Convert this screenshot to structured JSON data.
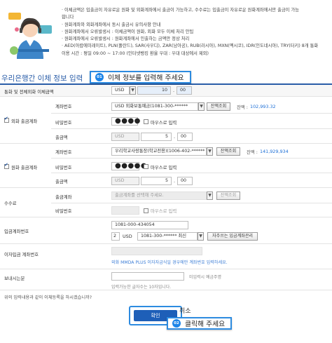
{
  "notice": {
    "lines": [
      "· 이체금액은 입출금이 자유로운 원화 및 외화계좌에서 출금이 가능하고, 수수료는 입출금이 자유로운 원화계좌에서만 출금이 가능",
      "  합니다",
      "· 원화계좌와 외화계좌에서 동시 출금시 유의사항 안내",
      "  · 원화계좌에서 오류발생시 : 이체금액이 원화, 외화 모두 이체 처리 안됨",
      "  · 원화계좌에서 오류발생시 : 원화계좌에서 인출하는 금액만 정상 처리",
      "· AED(아랍에미레이트), PLN(폴란드), SAR(사우디), ZAR(남아공), RUB(러시아), MXN(멕시코), IDR(인도네시아), TRY(터키) 8개 통화",
      "  이용 시간 : 평일 09:00 ~ 17:00 (인터넷뱅킹 환율 우대 : 우대 대상에서 제외)"
    ]
  },
  "section_title": "우리은행간 이체 정보 입력",
  "callout1": {
    "number": "01",
    "text": "이체 정보를 입력해 주세요"
  },
  "callout2": {
    "number": "02",
    "text": "클릭해 주세요"
  },
  "transfer": {
    "label": "통화 및 전체외화 이체금액",
    "currency": "USD",
    "amount_int": "10",
    "amount_dec": "00"
  },
  "fx_withdraw": {
    "group_label": "외화 출금계좌",
    "checked": true,
    "account_label": "계좌번호",
    "account_value": "USD 외화보통예금(1081-300-******",
    "lookup_btn": "잔액조회",
    "balance_label": "잔액 :",
    "balance_value": "102,993.32",
    "pw_label": "비밀번호",
    "pw_dots": "●●●●",
    "mouse_input": "마우스로 입력",
    "amount_label": "출금액",
    "amount_currency": "USD",
    "amount_int": "5",
    "amount_dec": "00"
  },
  "krw_withdraw": {
    "group_label": "원화 출금계좌",
    "checked": true,
    "account_label": "계좌번호",
    "account_value": "우리학교사랑통장(학교전용)(1006-402-******",
    "lookup_btn": "잔액조회",
    "balance_label": "잔액 :",
    "balance_value": "141,929,934",
    "pw_label": "비밀번호",
    "pw_dots": "●●●●●",
    "mouse_input": "마우스로 입력",
    "amount_label": "출금액",
    "amount_currency": "USD",
    "amount_int": "5",
    "amount_dec": "00"
  },
  "fee": {
    "group_label": "수수료",
    "account_label": "출금계좌",
    "account_placeholder": "출금계좌를 선택해 주세요.",
    "lookup_btn": "잔액조회",
    "pw_label": "비밀번호",
    "mouse_input": "마우스로 입력"
  },
  "deposit": {
    "label": "입금계좌번호",
    "account_value": "1081-000-434054",
    "count": "2",
    "currency": "USD",
    "account_select": "1081-300-****** 최신",
    "manage_btn": "자주쓰는 입금계좌관리"
  },
  "nickname": {
    "label": "이자입금 계좌번호",
    "note": "외화 MMDA PLUS 이자자금식일 경우에만 계좌번호 입력하세요."
  },
  "memo": {
    "label": "보내시는분",
    "hint": "미입력시 예금주명",
    "limit": "입력가능한 글자수는 10자입니다."
  },
  "confirm_question": "위의 입력내용과 같이 이체등록을 하시겠습니까?",
  "confirm_btn": "확인",
  "cancel_btn": "취소",
  "colors": {
    "accent": "#2a5da8",
    "balance": "#1b6ed6",
    "callout_border": "#2d8be0",
    "confirm_bg": "#1e5fb8"
  }
}
